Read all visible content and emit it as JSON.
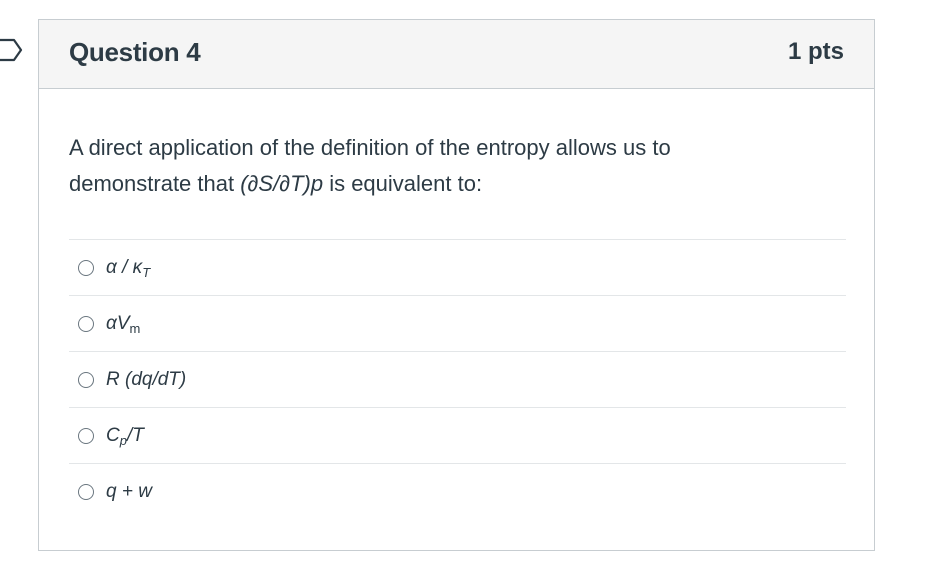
{
  "question": {
    "title": "Question 4",
    "points": "1 pts",
    "text_part1": "A direct application of the definition of the entropy allows us to demonstrate that ",
    "text_formula": "(∂S/∂T)p",
    "text_part2": " is equivalent to:"
  },
  "answers": [
    {
      "main": "α / κ",
      "sub": "T"
    },
    {
      "main": "αV",
      "sub": "m"
    },
    {
      "main": "R (dq/dT)",
      "sub": ""
    },
    {
      "main": "C",
      "sub": "p",
      "tail": "/T"
    },
    {
      "main": "q + w",
      "sub": ""
    }
  ],
  "colors": {
    "border": "#c7cdd1",
    "header_bg": "#f5f5f5",
    "text": "#2d3b45",
    "divider": "#e3e6e8"
  }
}
